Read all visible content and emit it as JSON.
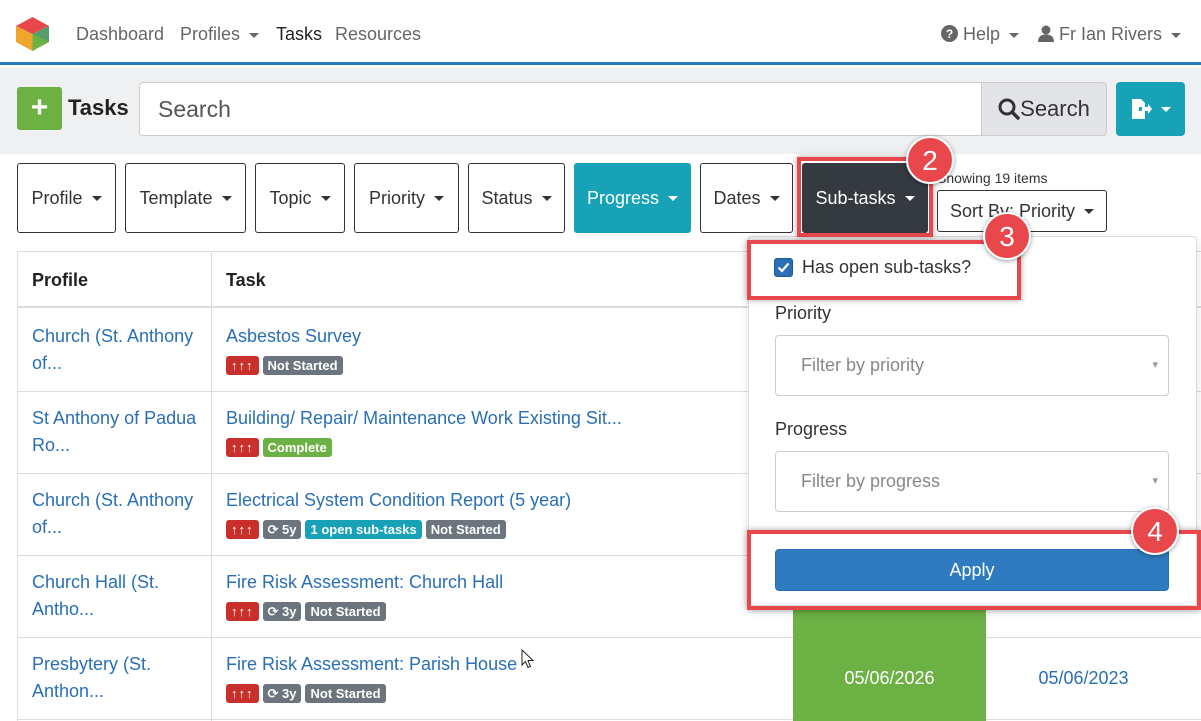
{
  "nav": {
    "links": [
      "Dashboard",
      "Profiles",
      "Tasks",
      "Resources"
    ],
    "help": "Help",
    "user": "Fr Ian Rivers"
  },
  "toolbar": {
    "add_icon": "plus-icon",
    "title": "Tasks",
    "search_placeholder": "Search",
    "search_button": "Search"
  },
  "filters": [
    "Profile",
    "Template",
    "Topic",
    "Priority",
    "Status",
    "Progress",
    "Dates",
    "Sub-tasks"
  ],
  "showing": "Showing 19 items",
  "sort_by": "Sort By: Priority",
  "table": {
    "headers": {
      "profile": "Profile",
      "task": "Task"
    },
    "rows": [
      {
        "profile": "Church (St. Anthony of...",
        "task": "Asbestos Survey",
        "priority": "↑↑↑",
        "badges": [
          "Not Started"
        ]
      },
      {
        "profile": "St Anthony of Padua Ro...",
        "task": "Building/ Repair/ Maintenance Work Existing Sit...",
        "priority": "↑↑↑",
        "badges": [
          "Complete"
        ]
      },
      {
        "profile": "Church (St. Anthony of...",
        "task": "Electrical System Condition Report (5 year)",
        "priority": "↑↑↑",
        "recur": "5y",
        "badges": [
          "1 open sub-tasks",
          "Not Started"
        ]
      },
      {
        "profile": "Church Hall (St. Antho...",
        "task": "Fire Risk Assessment: Church Hall",
        "priority": "↑↑↑",
        "recur": "3y",
        "badges": [
          "Not Started"
        ]
      },
      {
        "profile": "Presbytery (St. Anthon...",
        "task": "Fire Risk Assessment: Parish House",
        "priority": "↑↑↑",
        "recur": "3y",
        "badges": [
          "Not Started"
        ],
        "due": "05/06/2026",
        "last": "05/06/2023"
      }
    ]
  },
  "dropdown": {
    "checkbox_label": "Has open sub-tasks?",
    "checked": true,
    "priority_label": "Priority",
    "priority_placeholder": "Filter by priority",
    "progress_label": "Progress",
    "progress_placeholder": "Filter by progress",
    "apply": "Apply"
  },
  "annotations": [
    "2",
    "3",
    "4"
  ],
  "colors": {
    "accent": "#17a2b8",
    "highlight": "#e8474c",
    "link": "#2a6fb5",
    "green": "#6cb144",
    "red": "#c9302c"
  }
}
